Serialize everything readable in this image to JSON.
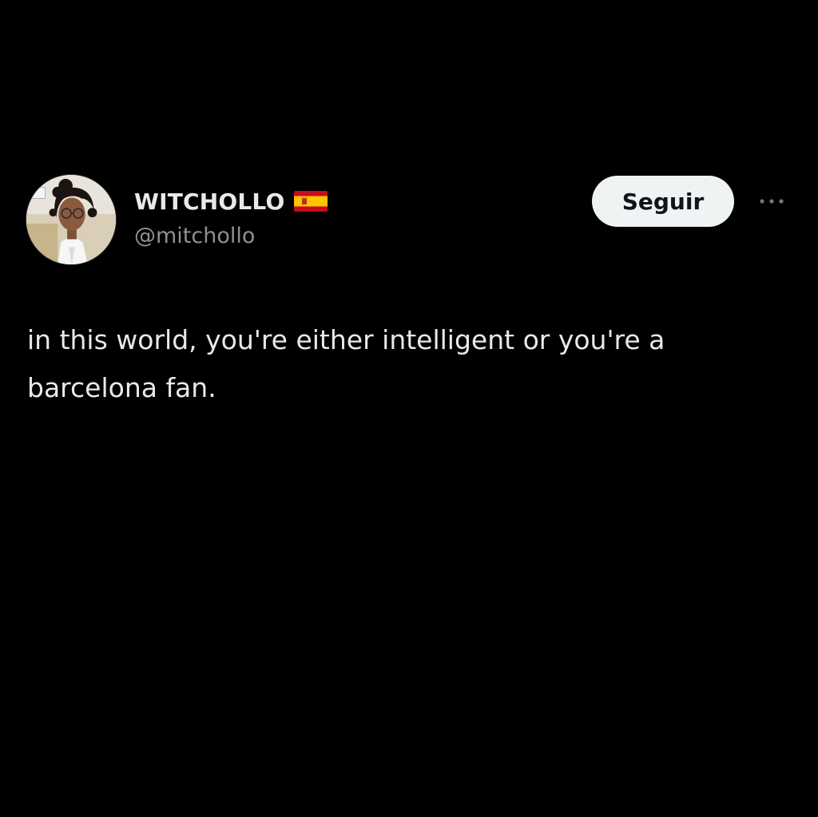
{
  "author": {
    "display_name": "WITCHOLLO",
    "handle": "@mitchollo",
    "flag_icon": "spain-flag-icon",
    "avatar_icon": "profile-photo"
  },
  "actions": {
    "follow_label": "Seguir",
    "more_icon": "more-options-icon"
  },
  "tweet": {
    "text": "in this world, you're either intelligent or you're a barcelona fan."
  },
  "colors": {
    "background": "#000000",
    "text_primary": "#e7e9ea",
    "text_secondary": "#8b9196",
    "button_bg": "#eff3f4",
    "button_text": "#0f1419"
  }
}
